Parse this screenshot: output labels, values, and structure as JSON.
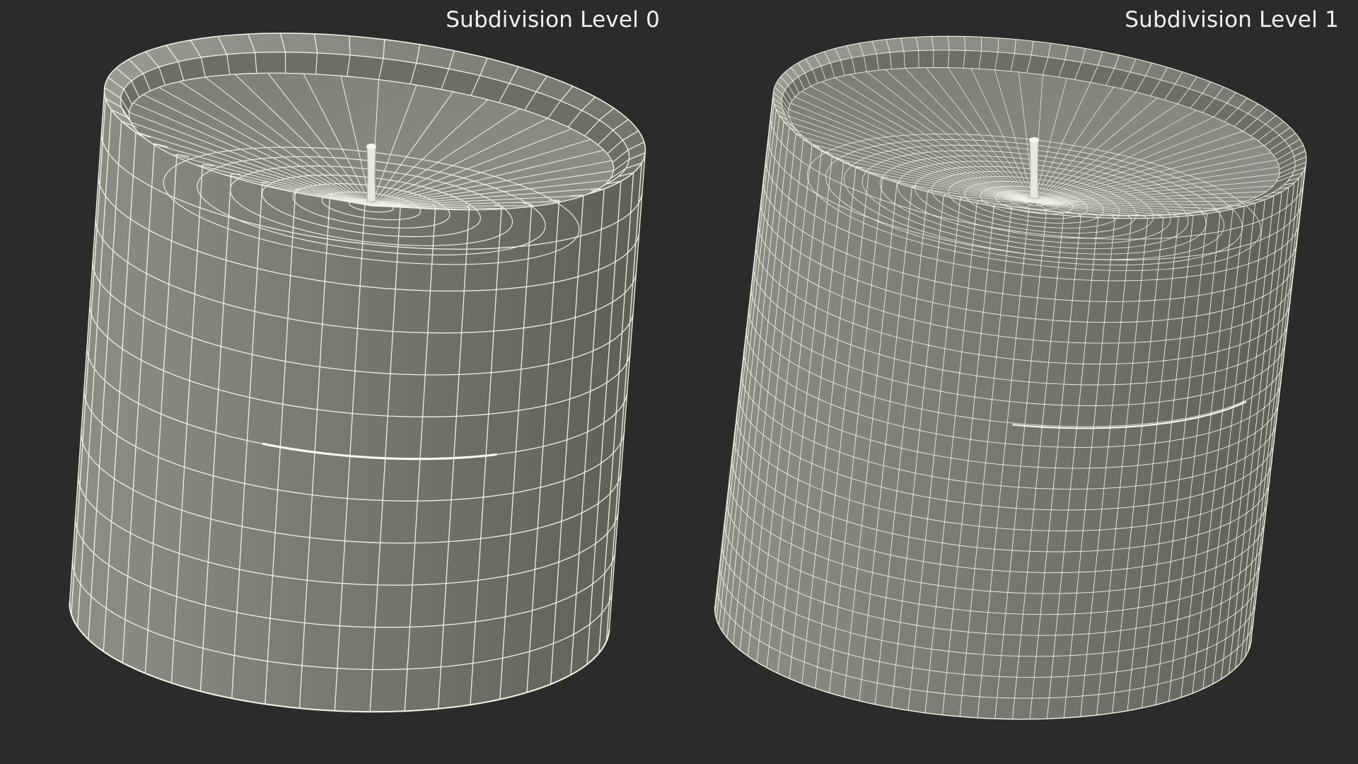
{
  "viewport": {
    "background_color": "#2b2b2b",
    "panels": [
      {
        "label": "Subdivision Level 0",
        "model": "candle-jar-wireframe",
        "subdivision_level": 0,
        "surface_color": "#787870",
        "wire_color": "#f0efe4"
      },
      {
        "label": "Subdivision Level 1",
        "model": "candle-jar-wireframe",
        "subdivision_level": 1,
        "surface_color": "#7a7a72",
        "wire_color": "#f0efe4"
      }
    ]
  }
}
